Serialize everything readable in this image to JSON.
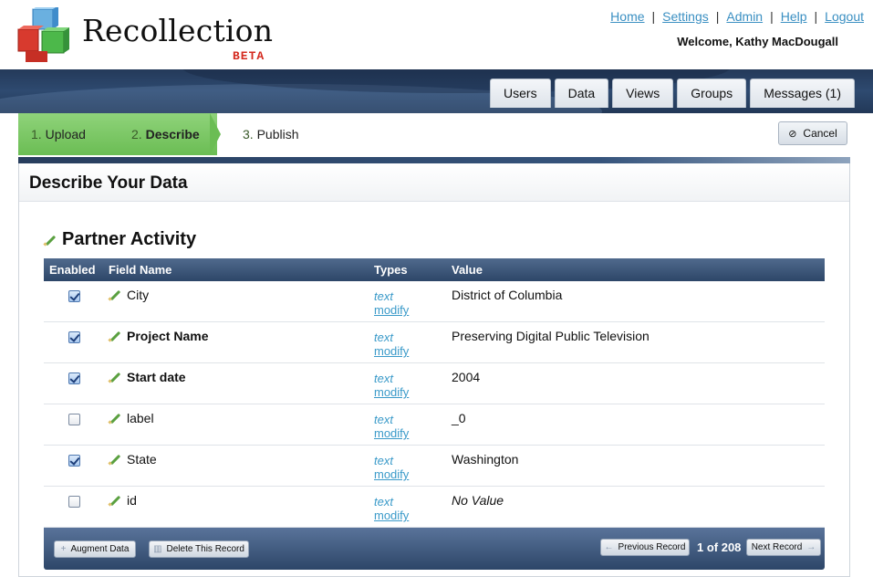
{
  "header": {
    "app_name": "Recollection",
    "beta_label": "BETA",
    "links": [
      "Home",
      "Settings",
      "Admin",
      "Help",
      "Logout"
    ],
    "welcome": "Welcome, Kathy MacDougall"
  },
  "tabs": [
    "Users",
    "Data",
    "Views",
    "Groups",
    "Messages (1)"
  ],
  "steps": [
    {
      "num": "1.",
      "label": "Upload",
      "state": "done"
    },
    {
      "num": "2.",
      "label": "Describe",
      "state": "current"
    },
    {
      "num": "3.",
      "label": "Publish",
      "state": "upcoming"
    }
  ],
  "cancel_label": "Cancel",
  "panel_title": "Describe Your Data",
  "record_title": "Partner Activity",
  "table": {
    "headers": {
      "enabled": "Enabled",
      "field": "Field Name",
      "types": "Types",
      "value": "Value"
    },
    "rows": [
      {
        "enabled": true,
        "field": "City",
        "bold": false,
        "type": "text",
        "modify": "modify",
        "value": "District of Columbia",
        "italic": false
      },
      {
        "enabled": true,
        "field": "Project Name",
        "bold": true,
        "type": "text",
        "modify": "modify",
        "value": "Preserving Digital Public Television",
        "italic": false
      },
      {
        "enabled": true,
        "field": "Start date",
        "bold": true,
        "type": "text",
        "modify": "modify",
        "value": "2004",
        "italic": false
      },
      {
        "enabled": false,
        "field": "label",
        "bold": false,
        "type": "text",
        "modify": "modify",
        "value": "_0",
        "italic": false
      },
      {
        "enabled": true,
        "field": "State",
        "bold": false,
        "type": "text",
        "modify": "modify",
        "value": "Washington",
        "italic": false
      },
      {
        "enabled": false,
        "field": "id",
        "bold": false,
        "type": "text",
        "modify": "modify",
        "value": "No Value",
        "italic": true
      }
    ]
  },
  "footer": {
    "augment": "Augment Data",
    "delete": "Delete This Record",
    "prev": "Previous Record",
    "pager": "1 of 208",
    "next": "Next Record"
  },
  "colors": {
    "accent_green": "#6bbd54",
    "navy": "#2d4668",
    "link_blue": "#3a8fc2"
  }
}
